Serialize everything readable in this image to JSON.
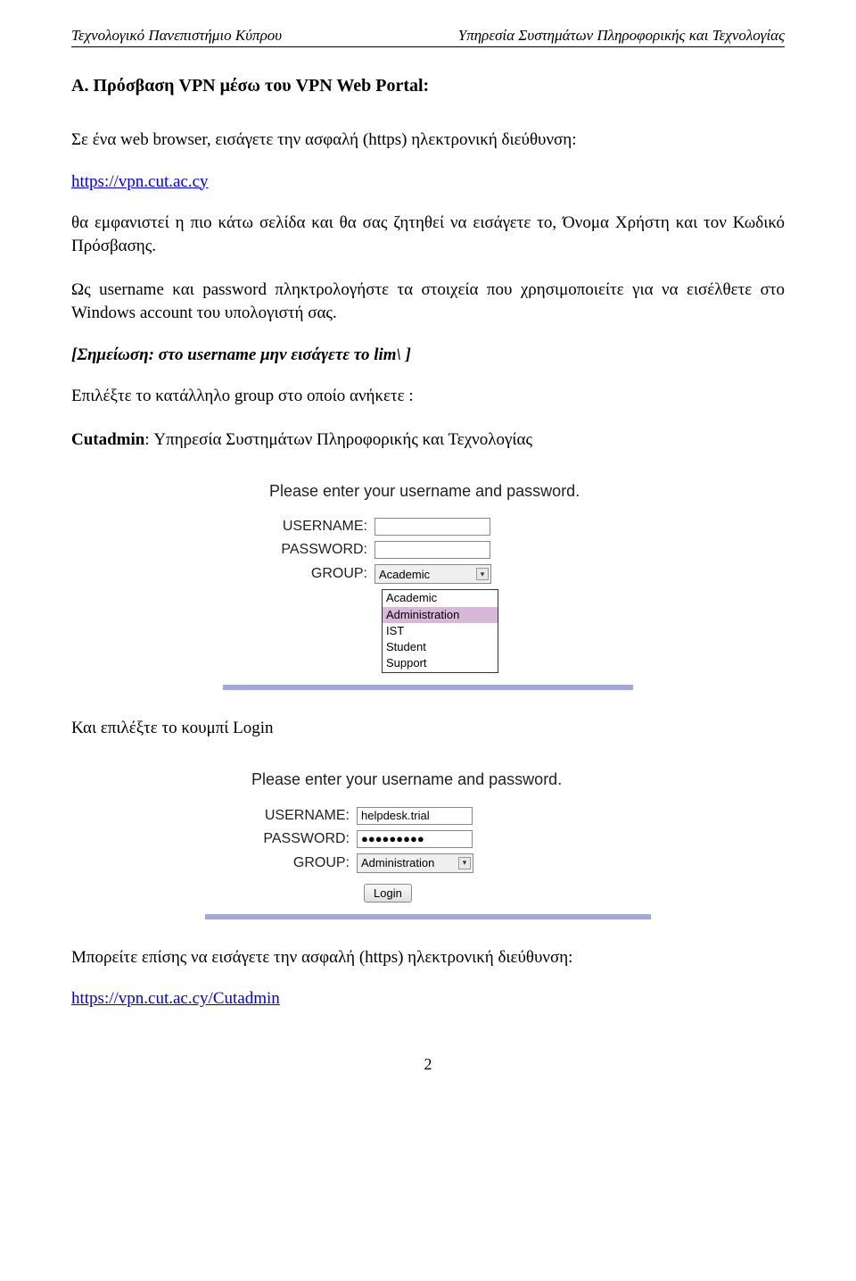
{
  "header": {
    "left": "Τεχνολογικό Πανεπιστήμιο Κύπρου",
    "right": "Υπηρεσία Συστημάτων Πληροφορικής και Τεχνολογίας"
  },
  "heading": "Α. Πρόσβαση VPN μέσω του VPN Web Portal:",
  "para1": "Σε ένα web browser, εισάγετε την ασφαλή (https) ηλεκτρονική διεύθυνση:",
  "link1": "https://vpn.cut.ac.cy",
  "para2": "θα εμφανιστεί η πιο κάτω σελίδα και θα σας ζητηθεί να εισάγετε το, Όνομα Χρήστη και τον Κωδικό Πρόσβασης.",
  "para3": "Ως username και password πληκτρολογήστε τα στοιχεία που χρησιμοποιείτε για να εισέλθετε στο Windows account του υπολογιστή σας.",
  "note": "[Σημείωση: στο username μην εισάγετε το lim\\ ]",
  "para4": "Επιλέξτε το κατάλληλο group στο οποίο ανήκετε :",
  "para5_bold": "Cutadmin",
  "para5_rest": ": Υπηρεσία Συστημάτων Πληροφορικής και Τεχνολογίας",
  "form1": {
    "prompt": "Please enter your username and password.",
    "labels": {
      "username": "USERNAME:",
      "password": "PASSWORD:",
      "group": "GROUP:"
    },
    "selected": "Academic",
    "options": [
      "Academic",
      "Administration",
      "IST",
      "Student",
      "Support"
    ],
    "highlight_index": 1
  },
  "para6": "Και επιλέξτε το κουμπί Login",
  "form2": {
    "prompt": "Please enter your username and password.",
    "labels": {
      "username": "USERNAME:",
      "password": "PASSWORD:",
      "group": "GROUP:"
    },
    "username_value": "helpdesk.trial",
    "password_mask": "●●●●●●●●●",
    "selected": "Administration",
    "login": "Login"
  },
  "para7": "Μπορείτε επίσης να εισάγετε την ασφαλή (https) ηλεκτρονική διεύθυνση:",
  "link2": "https://vpn.cut.ac.cy/Cutadmin",
  "page_number": "2"
}
